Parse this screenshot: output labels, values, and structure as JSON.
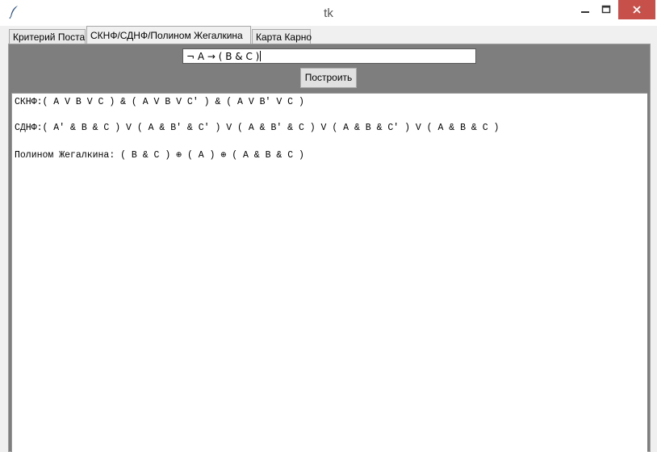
{
  "window": {
    "title": "tk",
    "icons": {
      "app": "feather-icon",
      "minimize": "minimize-icon",
      "maximize": "maximize-icon",
      "close": "close-icon"
    },
    "colors": {
      "close_button": "#c7514a",
      "pane_background": "#7e7e7e"
    }
  },
  "tabs": [
    {
      "label": "Критерий Поста",
      "active": false
    },
    {
      "label": "СКНФ/СДНФ/Полином Жегалкина",
      "active": true
    },
    {
      "label": "Карта Карно",
      "active": false
    }
  ],
  "formula": {
    "value": "¬ A → ( B & C )"
  },
  "build_button": {
    "label": "Построить"
  },
  "output": {
    "lines": [
      "СКНФ:( A V B V C ) & ( A V B V C' ) & ( A V B' V C )",
      "СДНФ:( A' & B & C ) V ( A & B' & C' ) V ( A & B' & C ) V ( A & B & C' ) V ( A & B & C )",
      "Полином Жегалкина: ( B & C ) ⊕ ( A ) ⊕ ( A & B & C )"
    ]
  }
}
